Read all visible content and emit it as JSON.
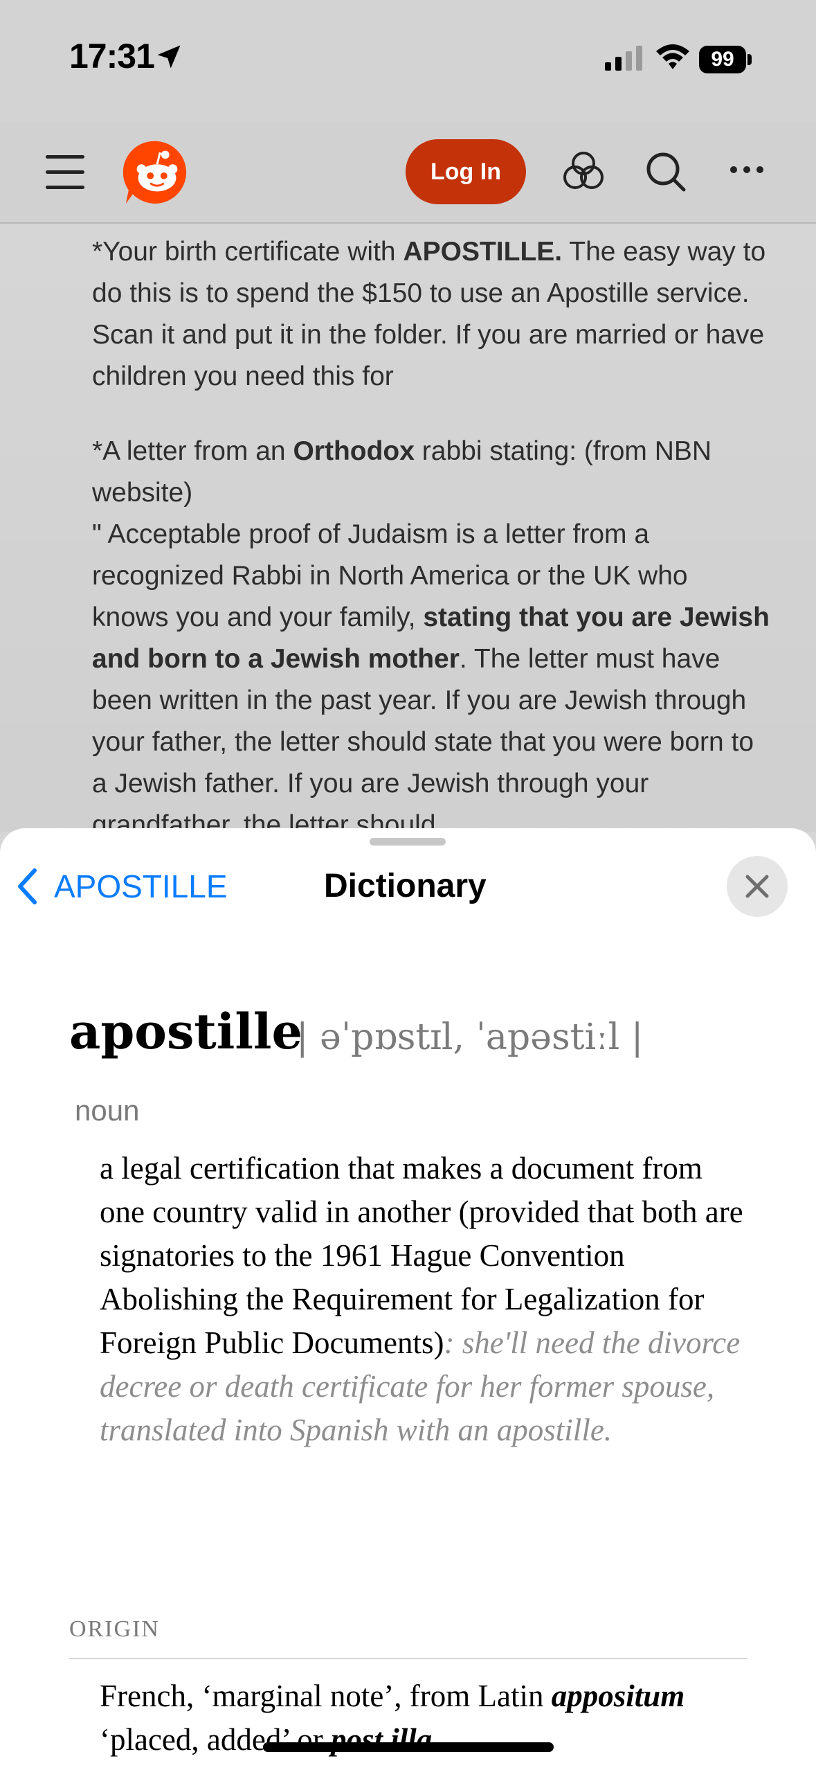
{
  "status_bar": {
    "time": "17:31",
    "battery": "99"
  },
  "header": {
    "login_label": "Log In"
  },
  "post": {
    "p1_pre": "*Your birth certificate with ",
    "p1_bold": "APOSTILLE.",
    "p1_post": " The easy way to do this is to spend the $150 to use an Apostille service. Scan it and put it in the folder. If you are married or have children you need this for",
    "p2_pre": "*A letter from an ",
    "p2_bold": "Orthodox",
    "p2_post": " rabbi stating: (from NBN website)",
    "p3_pre": "\" Acceptable proof of Judaism is a letter from a recognized Rabbi in North America or the UK who knows you and your family, ",
    "p3_bold": "stating that you are Jewish and born to a Jewish mother",
    "p3_post": ". The letter must have been written in the past year. If you are Jewish through your father, the letter should state that you were born to a Jewish father. If you are Jewish through your grandfather, the letter should"
  },
  "dictionary": {
    "back_label": "APOSTILLE",
    "title": "Dictionary",
    "headword": "apostille",
    "pronunciation": "| əˈpɒstɪl, ˈapəstiːl |",
    "part_of_speech": "noun",
    "definition": "a legal certification that makes a document from one country valid in another (provided that both are signatories to the 1961 Hague Convention Abolishing the Requirement for Legalization for Foreign Public Documents)",
    "example": ": she'll need the divorce decree or death certificate for her former spouse, translated into Spanish with an apostille.",
    "origin_label": "ORIGIN",
    "origin_pre": "French, ‘marginal note’, from Latin ",
    "origin_term1": "appositum",
    "origin_mid": " ‘placed, added’ or ",
    "origin_term2": "post illa"
  },
  "colors": {
    "accent": "#0a7cff",
    "login": "#c4320a",
    "reddit": "#ff4500"
  },
  "icons": [
    "location-arrow-icon",
    "signal-icon",
    "wifi-icon",
    "hamburger-icon",
    "reddit-logo",
    "advertise-icon",
    "search-icon",
    "more-icon",
    "chevron-left-icon",
    "close-icon"
  ]
}
